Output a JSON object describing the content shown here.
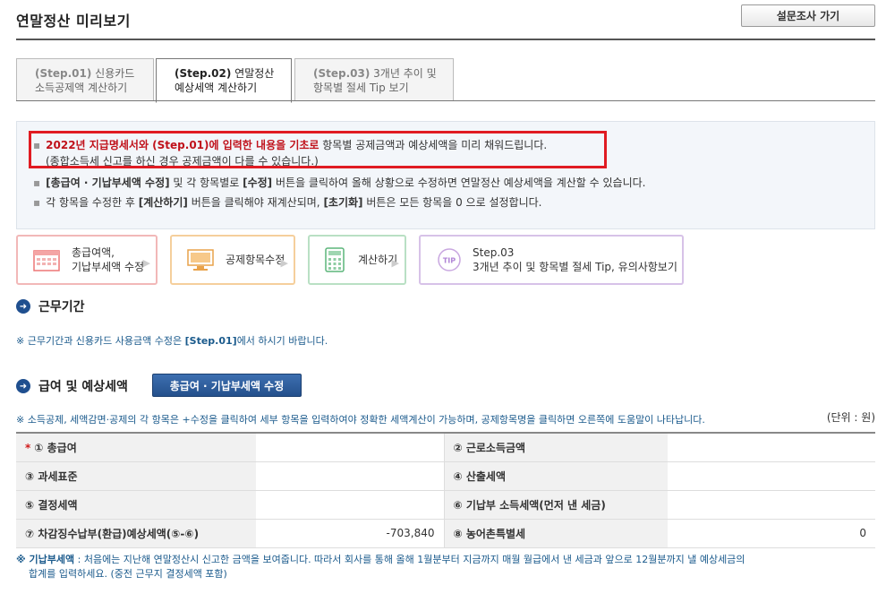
{
  "header": {
    "title": "연말정산 미리보기",
    "survey_button": "설문조사 가기"
  },
  "tabs": [
    {
      "step": "(Step.01)",
      "line1": "신용카드",
      "line2": "소득공제액 계산하기"
    },
    {
      "step": "(Step.02)",
      "line1": "연말정산",
      "line2": "예상세액 계산하기"
    },
    {
      "step": "(Step.03)",
      "line1": "3개년 추이 및",
      "line2": "항목별 절세 Tip 보기"
    }
  ],
  "info": {
    "line1_bold": "2022년 지급명세서와 (Step.01)에 입력한 내용을 기초로",
    "line1_rest": " 항목별 공제금액과 예상세액을 미리 채워드립니다.",
    "line1_sub": "(종합소득세 신고를 하신 경우 공제금액이 다를 수 있습니다.)",
    "line2_a": "[총급여 · 기납부세액 수정]",
    "line2_b": " 및 각 항목별로 ",
    "line2_c": "[수정]",
    "line2_d": " 버튼을 클릭하여 올해 상황으로 수정하면 연말정산 예상세액을 계산할 수 있습니다.",
    "line3_a": "각 항목을 수정한 후 ",
    "line3_b": "[계산하기]",
    "line3_c": " 버튼을 클릭해야 재계산되며, ",
    "line3_d": "[초기화]",
    "line3_e": " 버튼은 모든 항목을 0 으로 설정합니다."
  },
  "steps": [
    {
      "line1": "총급여액,",
      "line2": "기납부세액 수정",
      "icon": "calendar-icon"
    },
    {
      "line1": "공제항목수정",
      "icon": "monitor-icon"
    },
    {
      "line1": "계산하기",
      "icon": "calculator-icon"
    },
    {
      "badge": "TIP",
      "line1": "Step.03",
      "line2": "3개년 추이 및 항목별 절세 Tip, 유의사항보기",
      "icon": "tip-icon"
    }
  ],
  "work_period": {
    "title": "근무기간",
    "note_a": "※ 근무기간과 신용카드 사용금액 수정은 ",
    "note_b": "[Step.01]",
    "note_c": "에서 하시기 바랍니다."
  },
  "salary": {
    "title": "급여 및 예상세액",
    "edit_button": "총급여 · 기납부세액 수정",
    "note": "※ 소득공제, 세액감면·공제의 각 항목은 +수정을 클릭하여 세부 항목을 입력하여야 정확한 세액계산이 가능하며, 공제항목명을 클릭하면 오른쪽에 도움말이 나타납니다.",
    "unit": "(단위 : 원)"
  },
  "table": {
    "rows": [
      {
        "l1": "① 총급여",
        "v1": "",
        "l2": "② 근로소득금액",
        "v2": ""
      },
      {
        "l1": "③ 과세표준",
        "v1": "",
        "l2": "④ 산출세액",
        "v2": ""
      },
      {
        "l1": "⑤ 결정세액",
        "v1": "",
        "l2": "⑥ 기납부 소득세액(먼저 낸 세금)",
        "v2": ""
      },
      {
        "l1": "⑦ 차감징수납부(환급)예상세액(⑤-⑥)",
        "v1": "-703,840",
        "l2": "⑧ 농어촌특별세",
        "v2": "0"
      }
    ]
  },
  "footer": {
    "a": "※ 기납부세액",
    "b": " : 처음에는 지난해 연말정산시 신고한 금액을 보여줍니다. 따라서 회사를 통해 올해 1월분부터 지금까지 매월 월급에서 낸 세금과 앞으로 12월분까지 낼 예상세금의",
    "c": "합계를 입력하세요. (중전 근무지 결정세액 포함)"
  },
  "colors": {
    "accent": "#24508c",
    "red": "#c0121b",
    "card1": "#f2b8b8",
    "card2": "#f5cf9c",
    "card3": "#b9e0c4",
    "card4": "#d7c2e8"
  }
}
